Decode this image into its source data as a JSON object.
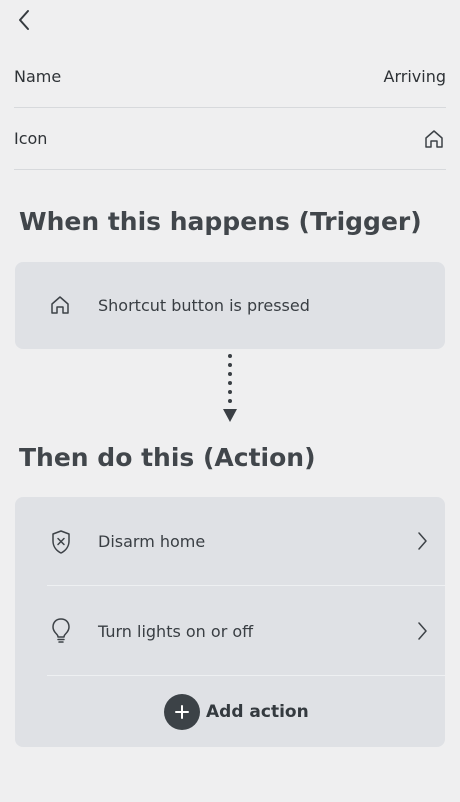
{
  "header": {
    "back_icon": "chevron-left-icon"
  },
  "settings": {
    "name_label": "Name",
    "name_value": "Arriving",
    "icon_label": "Icon",
    "icon_value": "home-icon"
  },
  "trigger": {
    "title": "When this happens (Trigger)",
    "item": {
      "icon": "home-icon",
      "label": "Shortcut button is pressed"
    }
  },
  "action": {
    "title": "Then do this (Action)",
    "items": [
      {
        "icon": "shield-x-icon",
        "label": "Disarm home"
      },
      {
        "icon": "lightbulb-icon",
        "label": "Turn lights on or off"
      }
    ],
    "add_label": "Add action"
  },
  "colors": {
    "background": "#efeff0",
    "card": "#dfe1e5",
    "text": "#2f3438",
    "add_button": "#3c4247"
  }
}
